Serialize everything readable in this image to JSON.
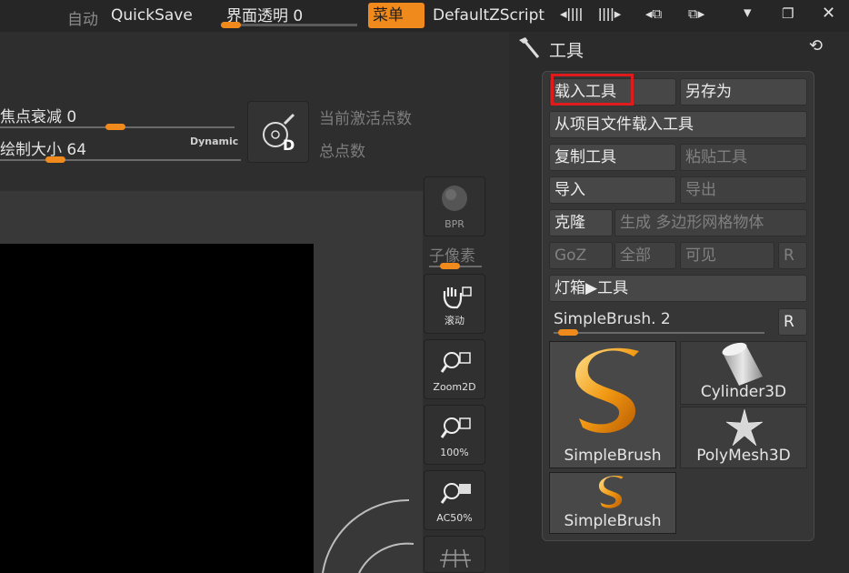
{
  "topbar": {
    "auto_label": "自动",
    "quicksave_label": "QuickSave",
    "transparency_label": "界面透明 0",
    "menu_label": "菜单",
    "script_label": "DefaultZScript",
    "icons": [
      "arrows-left-right-icon",
      "arrows-right-icon",
      "layout-left-icon",
      "layout-right-icon"
    ],
    "window_controls": [
      "minimize-icon",
      "restore-icon",
      "close-icon"
    ]
  },
  "left": {
    "focal_falloff_label": "焦点衰减 0",
    "draw_size_label": "绘制大小 64",
    "dynamic_label": "Dynamic",
    "active_points_label": "当前激活点数",
    "total_points_label": "总点数",
    "bpr_label": "BPR",
    "subpixel_label": "子像素",
    "tools": [
      {
        "label": "滚动"
      },
      {
        "label": "Zoom2D"
      },
      {
        "label": "100%"
      },
      {
        "label": "AC50%"
      }
    ]
  },
  "tool_panel": {
    "title": "工具",
    "buttons": {
      "load_tool": "载入工具",
      "save_as": "另存为",
      "load_from_project": "从项目文件载入工具",
      "copy_tool": "复制工具",
      "paste_tool": "粘贴工具",
      "import": "导入",
      "export": "导出",
      "clone": "克隆",
      "make_polymesh": "生成 多边形网格物体",
      "goz": "GoZ",
      "all": "全部",
      "visible": "可见",
      "r_small": "R",
      "lightbox_tools": "灯箱▶工具",
      "r_button": "R"
    },
    "current_tool_label": "SimpleBrush. 2",
    "thumbnails": [
      {
        "caption": "SimpleBrush"
      },
      {
        "caption": "Cylinder3D"
      },
      {
        "caption": "PolyMesh3D"
      },
      {
        "caption": "SimpleBrush"
      }
    ]
  },
  "colors": {
    "accent": "#f08a1c",
    "highlight_box": "#e01b1b"
  }
}
